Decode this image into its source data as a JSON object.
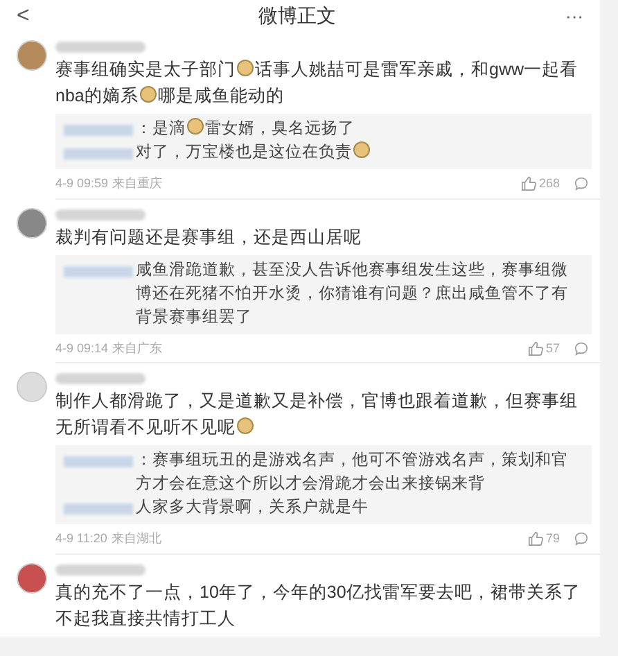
{
  "header": {
    "back": "<",
    "title": "微博正文",
    "more": "···"
  },
  "comments": [
    {
      "text": [
        {
          "text": "赛事组确实是太子部门"
        },
        {
          "kind": "emoji"
        },
        {
          "text": "话事人姚喆可是雷军亲戚，和gww一起看nba的嫡系"
        },
        {
          "kind": "emoji"
        },
        {
          "text": "哪是咸鱼能动的"
        }
      ],
      "replies": [
        [
          {
            "text": "：是滴"
          },
          {
            "kind": "emoji"
          },
          {
            "text": "雷女婿，臭名远扬了"
          }
        ],
        [
          {
            "text": "对了，万宝楼也是这位在负责"
          },
          {
            "kind": "emoji"
          }
        ]
      ],
      "time": "4-9 09:59",
      "source": "来自重庆",
      "likes": "268"
    },
    {
      "text": [
        {
          "text": "裁判有问题还是赛事组，还是西山居呢"
        }
      ],
      "replies": [
        [
          {
            "text": "咸鱼滑跪道歉，甚至没人告诉他赛事组发生这些，赛事组微博还在死猪不怕开水烫，你猜谁有问题？庶出咸鱼管不了有背景赛事组罢了"
          }
        ]
      ],
      "time": "4-9 09:14",
      "source": "来自广东",
      "likes": "57"
    },
    {
      "text": [
        {
          "text": "制作人都滑跪了，又是道歉又是补偿，官博也跟着道歉，但赛事组无所谓看不见听不见呢"
        },
        {
          "kind": "emoji"
        }
      ],
      "replies": [
        [
          {
            "text": "：赛事组玩丑的是游戏名声，他可不管游戏名声，策划和官方才会在意这个所以才会滑跪才会出来接锅来背"
          }
        ],
        [
          {
            "text": "人家多大背景啊，关系户就是牛"
          }
        ]
      ],
      "time": "4-9 11:20",
      "source": "来自湖北",
      "likes": "79"
    },
    {
      "text": [
        {
          "text": "真的充不了一点，10年了，今年的30亿找雷军要去吧，裙带关系了不起我直接共情打工人"
        }
      ]
    }
  ]
}
